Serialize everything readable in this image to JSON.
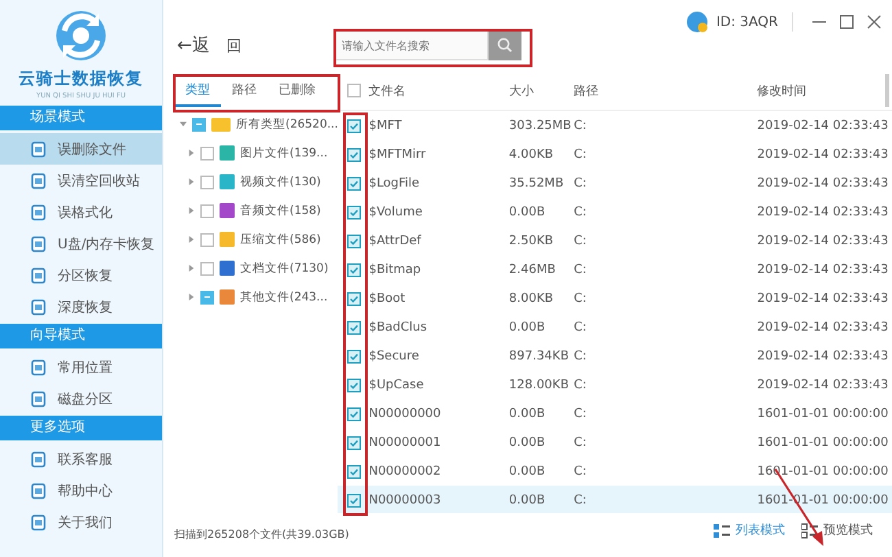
{
  "app": {
    "title": "云骑士数据恢复",
    "subtitle": "YUN QI SHI SHU JU HUI FU",
    "user_id": "ID: 3AQR"
  },
  "sidebar": [
    {
      "header": "场景模式",
      "items": [
        {
          "label": "误删除文件",
          "selected": true
        },
        {
          "label": "误清空回收站",
          "selected": false
        },
        {
          "label": "误格式化",
          "selected": false
        },
        {
          "label": "U盘/内存卡恢复",
          "selected": false
        },
        {
          "label": "分区恢复",
          "selected": false
        },
        {
          "label": "深度恢复",
          "selected": false
        }
      ]
    },
    {
      "header": "向导模式",
      "items": [
        {
          "label": "常用位置",
          "selected": false
        },
        {
          "label": "磁盘分区",
          "selected": false
        }
      ]
    },
    {
      "header": "更多选项",
      "items": [
        {
          "label": "联系客服",
          "selected": false
        },
        {
          "label": "帮助中心",
          "selected": false
        },
        {
          "label": "关于我们",
          "selected": false
        }
      ]
    }
  ],
  "toolbar": {
    "back": "←返",
    "up": "回",
    "search": {
      "placeholder": "请输入文件名搜索"
    }
  },
  "tabs": [
    {
      "label": "类型",
      "selected": true
    },
    {
      "label": "路径",
      "selected": false
    },
    {
      "label": "已删除",
      "selected": false
    }
  ],
  "tree": [
    {
      "label": "所有类型(26520...",
      "expanded": true,
      "indeterminate": true,
      "color": "#f6c12c",
      "children": [
        {
          "label": "图片文件(139...",
          "expanded": false,
          "indeterminate": false,
          "color": "#2bb5a6"
        },
        {
          "label": "视频文件(130)",
          "expanded": false,
          "indeterminate": false,
          "color": "#2bb5c8"
        },
        {
          "label": "音频文件(158)",
          "expanded": false,
          "indeterminate": false,
          "color": "#a248c8"
        },
        {
          "label": "压缩文件(586)",
          "expanded": false,
          "indeterminate": false,
          "color": "#f6b92c"
        },
        {
          "label": "文档文件(7130)",
          "expanded": false,
          "indeterminate": false,
          "color": "#2e6fd0"
        },
        {
          "label": "其他文件(243...",
          "expanded": false,
          "indeterminate": true,
          "color": "#e9883a"
        }
      ]
    }
  ],
  "table": {
    "all_checked": false,
    "columns": [
      "文件名",
      "大小",
      "路径",
      "修改时间"
    ],
    "rows": [
      {
        "checked": true,
        "selected": false,
        "cells": [
          "$MFT",
          "303.25MB",
          "C:",
          "2019-02-14 02:33:43"
        ]
      },
      {
        "checked": true,
        "selected": false,
        "cells": [
          "$MFTMirr",
          "4.00KB",
          "C:",
          "2019-02-14 02:33:43"
        ]
      },
      {
        "checked": true,
        "selected": false,
        "cells": [
          "$LogFile",
          "35.52MB",
          "C:",
          "2019-02-14 02:33:43"
        ]
      },
      {
        "checked": true,
        "selected": false,
        "cells": [
          "$Volume",
          "0.00B",
          "C:",
          "2019-02-14 02:33:43"
        ]
      },
      {
        "checked": true,
        "selected": false,
        "cells": [
          "$AttrDef",
          "2.50KB",
          "C:",
          "2019-02-14 02:33:43"
        ]
      },
      {
        "checked": true,
        "selected": false,
        "cells": [
          "$Bitmap",
          "2.46MB",
          "C:",
          "2019-02-14 02:33:43"
        ]
      },
      {
        "checked": true,
        "selected": false,
        "cells": [
          "$Boot",
          "8.00KB",
          "C:",
          "2019-02-14 02:33:43"
        ]
      },
      {
        "checked": true,
        "selected": false,
        "cells": [
          "$BadClus",
          "0.00B",
          "C:",
          "2019-02-14 02:33:43"
        ]
      },
      {
        "checked": true,
        "selected": false,
        "cells": [
          "$Secure",
          "897.34KB",
          "C:",
          "2019-02-14 02:33:43"
        ]
      },
      {
        "checked": true,
        "selected": false,
        "cells": [
          "$UpCase",
          "128.00KB",
          "C:",
          "2019-02-14 02:33:43"
        ]
      },
      {
        "checked": true,
        "selected": false,
        "cells": [
          "N00000000",
          "0.00B",
          "C:",
          "1601-01-01 00:00:00"
        ]
      },
      {
        "checked": true,
        "selected": false,
        "cells": [
          "N00000001",
          "0.00B",
          "C:",
          "1601-01-01 00:00:00"
        ]
      },
      {
        "checked": true,
        "selected": false,
        "cells": [
          "N00000002",
          "0.00B",
          "C:",
          "1601-01-01 00:00:00"
        ]
      },
      {
        "checked": true,
        "selected": true,
        "cells": [
          "N00000003",
          "0.00B",
          "C:",
          "1601-01-01 00:00:00"
        ]
      }
    ]
  },
  "footer": {
    "summary": "扫描到265208个文件(共39.03GB)",
    "views": [
      {
        "label": "列表模式",
        "selected": true
      },
      {
        "label": "预览模式",
        "selected": false
      }
    ]
  }
}
